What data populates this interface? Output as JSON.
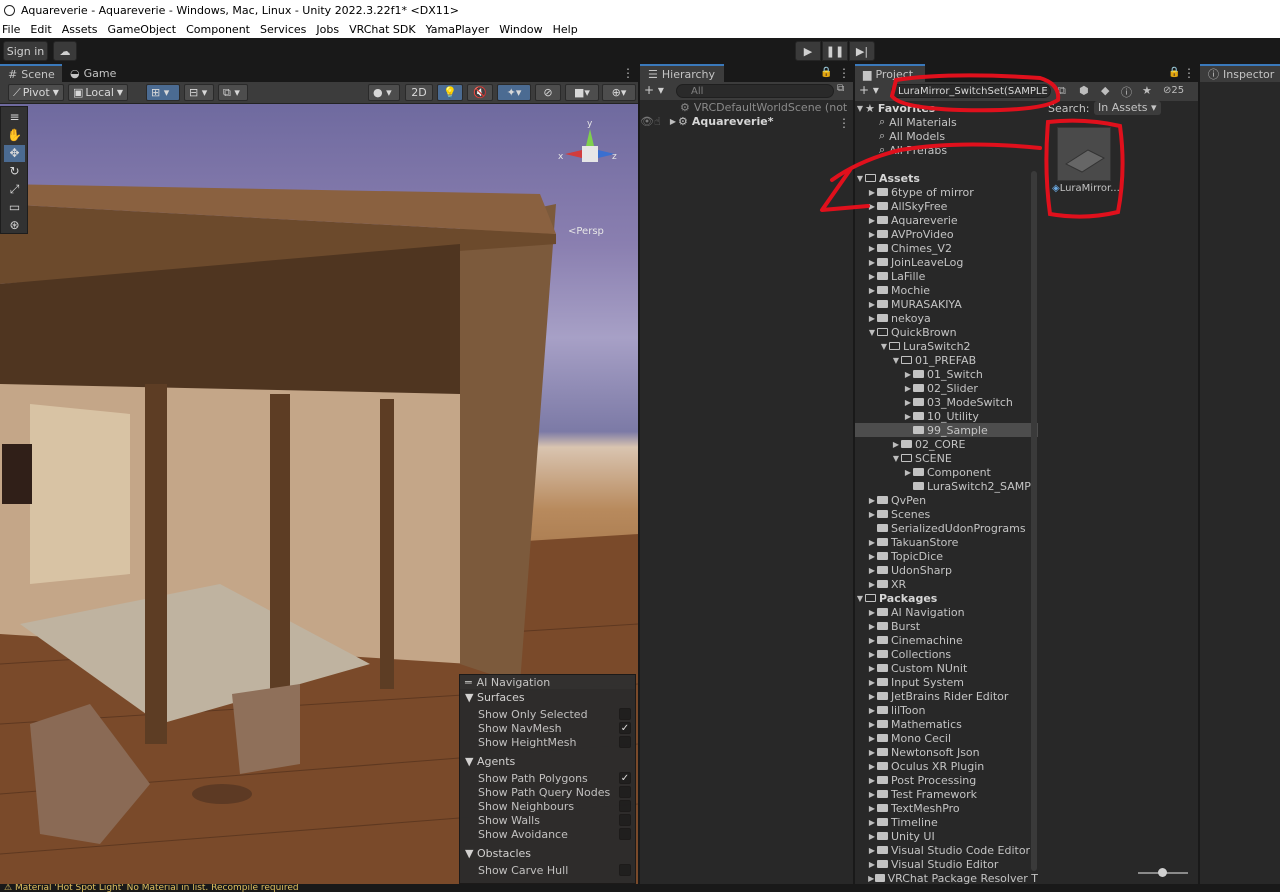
{
  "window": {
    "title": "Aquareverie - Aquareverie - Windows, Mac, Linux - Unity 2022.3.22f1* <DX11>"
  },
  "menu": [
    "File",
    "Edit",
    "Assets",
    "GameObject",
    "Component",
    "Services",
    "Jobs",
    "VRChat SDK",
    "YamaPlayer",
    "Window",
    "Help"
  ],
  "toolbar": {
    "signin": "Sign in"
  },
  "scene": {
    "tab_scene": "Scene",
    "tab_game": "Game",
    "pivot": "Pivot",
    "local": "Local",
    "mode_2d": "2D",
    "persp": "<Persp"
  },
  "ainav": {
    "title": "AI Navigation",
    "surfaces": "Surfaces",
    "surface_items": [
      {
        "label": "Show Only Selected",
        "checked": false
      },
      {
        "label": "Show NavMesh",
        "checked": true
      },
      {
        "label": "Show HeightMesh",
        "checked": false
      }
    ],
    "agents": "Agents",
    "agent_items": [
      {
        "label": "Show Path Polygons",
        "checked": true
      },
      {
        "label": "Show Path Query Nodes",
        "checked": false
      },
      {
        "label": "Show Neighbours",
        "checked": false
      },
      {
        "label": "Show Walls",
        "checked": false
      },
      {
        "label": "Show Avoidance",
        "checked": false
      }
    ],
    "obstacles": "Obstacles",
    "obstacle_items": [
      {
        "label": "Show Carve Hull",
        "checked": false
      }
    ]
  },
  "hierarchy": {
    "tab": "Hierarchy",
    "search_placeholder": "All",
    "items": [
      "VRCDefaultWorldScene (not",
      "Aquareverie*"
    ]
  },
  "project": {
    "tab": "Project",
    "search_value": "LuraMirror_SwitchSet(SAMPLE",
    "badge_count": "25",
    "search_label": "Search:",
    "search_scope": "In Assets",
    "favorites": "Favorites",
    "favorite_items": [
      "All Materials",
      "All Models",
      "All Prefabs"
    ],
    "assets": "Assets",
    "asset_items": [
      "6type of mirror",
      "AllSkyFree",
      "Aquareverie",
      "AVProVideo",
      "Chimes_V2",
      "JoinLeaveLog",
      "LaFille",
      "Mochie",
      "MURASAKIYA",
      "nekoya"
    ],
    "quickbrown": "QuickBrown",
    "luraswitch": "LuraSwitch2",
    "prefab": "01_PREFAB",
    "prefab_children": [
      "01_Switch",
      "02_Slider",
      "03_ModeSwitch",
      "10_Utility",
      "99_Sample"
    ],
    "core": "02_CORE",
    "scene": "SCENE",
    "scene_children": [
      "Component",
      "LuraSwitch2_SAMP"
    ],
    "asset_items_2": [
      "QvPen",
      "Scenes",
      "SerializedUdonPrograms",
      "TakuanStore",
      "TopicDice",
      "UdonSharp",
      "XR"
    ],
    "packages": "Packages",
    "package_items": [
      "AI Navigation",
      "Burst",
      "Cinemachine",
      "Collections",
      "Custom NUnit",
      "Input System",
      "JetBrains Rider Editor",
      "lilToon",
      "Mathematics",
      "Mono Cecil",
      "Newtonsoft Json",
      "Oculus XR Plugin",
      "Post Processing",
      "Test Framework",
      "TextMeshPro",
      "Timeline",
      "Unity UI",
      "Visual Studio Code Editor",
      "Visual Studio Editor",
      "VRChat Package Resolver T"
    ],
    "result_label": "LuraMirror..."
  },
  "inspector": {
    "tab": "Inspector"
  },
  "status": {
    "text": "Material 'Hot Spot Light' No Material in list.  Recompile required"
  },
  "colors": {
    "accent": "#3a79bb",
    "annotation": "#e0101c"
  }
}
